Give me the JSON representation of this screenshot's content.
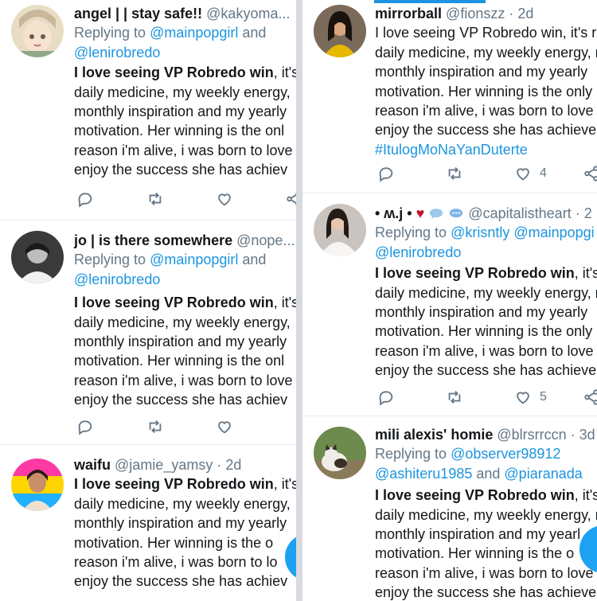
{
  "left": {
    "tweets": [
      {
        "name": "angel | | stay safe!!",
        "handle": "@kakyoma...",
        "reply_prefix": "Replying to ",
        "reply_line1_mention": "@mainpopgirl",
        "reply_line1_suffix": " and",
        "reply_line2_mention": "@lenirobredo",
        "body_bold": "I love seeing VP Robredo win",
        "body": [
          ", it's",
          "daily medicine, my weekly energy,",
          "monthly inspiration and my yearly",
          "motivation. Her winning is the onl",
          "reason i'm alive, i was born to love",
          "enjoy the success she has achiev"
        ],
        "avatar": "anime-girl-avatar"
      },
      {
        "name": "jo | is there somewhere",
        "handle": "@nope...",
        "reply_prefix": "Replying to ",
        "reply_line1_mention": "@mainpopgirl",
        "reply_line1_suffix": " and",
        "reply_line2_mention": "@lenirobredo",
        "body_bold": "I love seeing VP Robredo win",
        "body": [
          ", it's",
          "daily medicine, my weekly energy,",
          "monthly inspiration and my yearly",
          "motivation. Her winning is the onl",
          "reason i'm alive, i was born to love",
          "enjoy the success she has achiev"
        ],
        "avatar": "grayscale-portrait-avatar"
      },
      {
        "name": "waifu",
        "handle": "@jamie_yamsy",
        "dot": "·",
        "time": "2d",
        "body_bold": "I love seeing VP Robredo win",
        "body": [
          ", it's",
          "daily medicine, my weekly energy,",
          "monthly inspiration and my yearly",
          "motivation. Her winning is the o",
          "reason i'm alive, i was born to lo",
          "enjoy the success she has achiev"
        ],
        "avatar": "pride-flag-illustration-avatar"
      }
    ]
  },
  "right": {
    "tweets": [
      {
        "name": "mirrorball",
        "handle": "@fionszz",
        "dot": "·",
        "time": "2d",
        "body": [
          "I love seeing VP Robredo win, it's r",
          "daily medicine, my weekly energy, r",
          "monthly inspiration and my yearly",
          "motivation. Her winning is the only",
          "reason i'm alive, i was born to love",
          "enjoy the success she has achieve"
        ],
        "hashtag": "#ItulogMoNaYanDuterte",
        "like_count": "4",
        "avatar": "woman-yellow-top-avatar"
      },
      {
        "name": "• ʍ.j •",
        "heart": "♥",
        "handle": "@capitalistheart",
        "dot": "·",
        "time": "2",
        "reply_prefix": "Replying to ",
        "reply_line1_mention": "@krisntly @mainpopgi",
        "reply_line2_mention": "@lenirobredo",
        "body_bold": "I love seeing VP Robredo win",
        "body": [
          ", it's r",
          "daily medicine, my weekly energy, r",
          "monthly inspiration and my yearly",
          "motivation. Her winning is the only",
          "reason i'm alive, i was born to love",
          "enjoy the success she has achieve"
        ],
        "like_count": "5",
        "avatar": "woman-white-dress-avatar"
      },
      {
        "name": "mili alexis' homie",
        "handle": "@blrsrrccn",
        "dot": "·",
        "time": "3d",
        "reply_prefix": "Replying to ",
        "reply_line1_mention": "@observer98912",
        "reply_line2_mention": "@ashiteru1985",
        "reply_line2_mid": " and ",
        "reply_line2_mention2": "@piaranada",
        "body_bold": "I love seeing VP Robredo win",
        "body": [
          ", it's r",
          "daily medicine, my weekly energy, r",
          "monthly inspiration and my yearl",
          "motivation. Her winning is the o",
          "reason i'm alive, i was born to love",
          "enjoy the success she has achieve"
        ],
        "avatar": "cat-photo-avatar"
      }
    ]
  },
  "colors": {
    "link": "#1b95e0",
    "secondary_text": "#657786",
    "fab": "#1da1f2",
    "divider": "#d7dade"
  }
}
